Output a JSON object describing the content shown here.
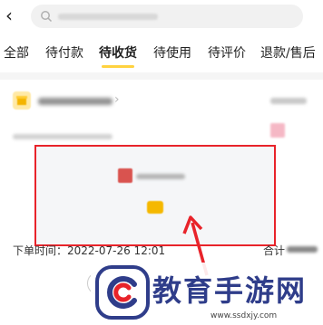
{
  "header": {
    "back_icon": "back-arrow-icon",
    "search_icon": "search-icon"
  },
  "tabs": [
    {
      "label": "全部"
    },
    {
      "label": "待付款"
    },
    {
      "label": "待收货"
    },
    {
      "label": "待使用"
    },
    {
      "label": "待评价"
    },
    {
      "label": "退款/售后"
    }
  ],
  "order": {
    "shop_icon": "shop-icon",
    "order_time": "下单时间：2022-07-26 12:01",
    "total_label": "合计"
  },
  "annotation": {
    "highlight_color": "#e8232a",
    "arrow_color": "#e8232a"
  },
  "watermark": {
    "text": "教育手游网",
    "url": "www.ssdxjy.com",
    "color": "#2f3d8a",
    "accent": "#e8232a"
  }
}
